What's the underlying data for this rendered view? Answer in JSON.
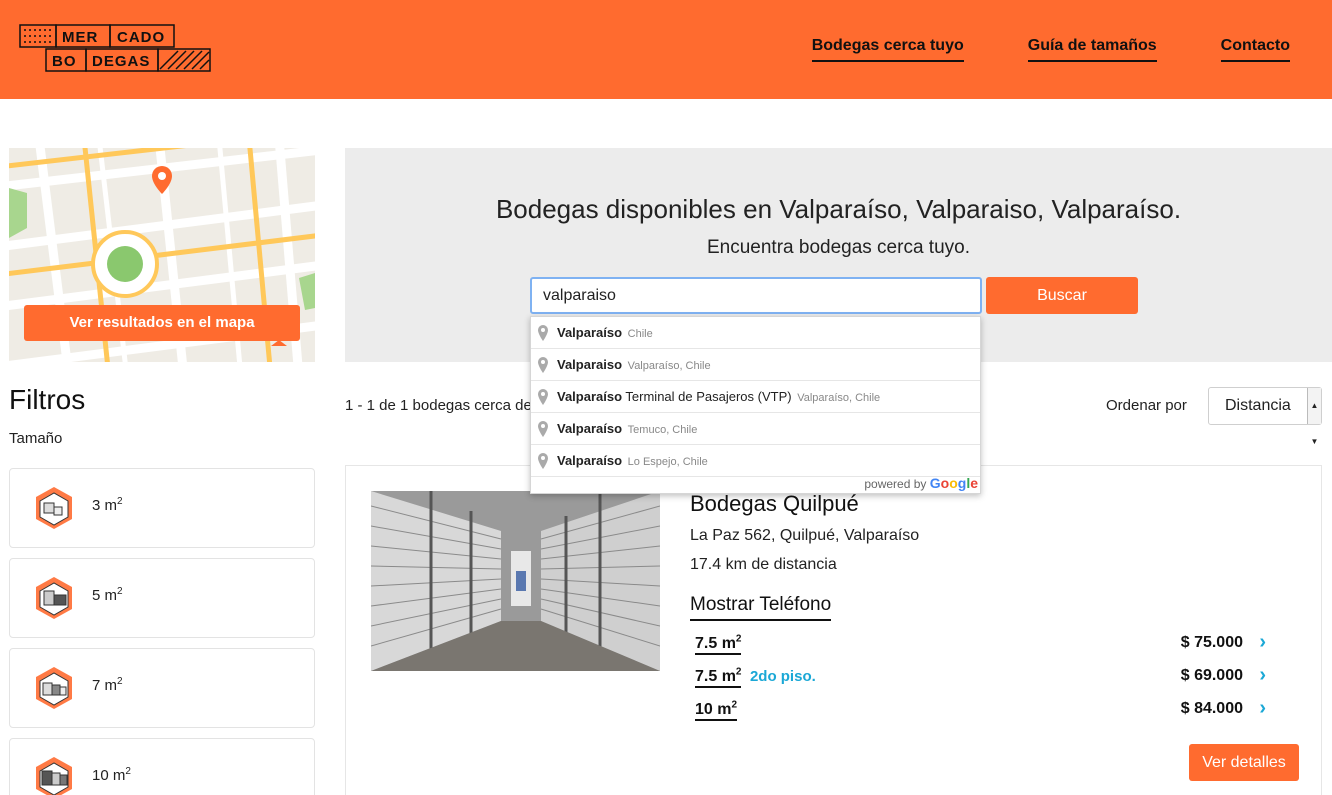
{
  "header": {
    "logo_words": [
      "MER",
      "CADO",
      "BO",
      "DEGAS"
    ],
    "nav": [
      "Bodegas cerca tuyo",
      "Guía de tamaños",
      "Contacto"
    ]
  },
  "map": {
    "button_label": "Ver resultados en el mapa"
  },
  "filters": {
    "title": "Filtros",
    "subtitle": "Tamaño",
    "sizes": [
      {
        "value": "3 m",
        "exp": "2"
      },
      {
        "value": "5 m",
        "exp": "2"
      },
      {
        "value": "7 m",
        "exp": "2"
      },
      {
        "value": "10 m",
        "exp": "2"
      }
    ]
  },
  "hero": {
    "title": "Bodegas disponibles en Valparaíso, Valparaiso, Valparaíso.",
    "subtitle": "Encuentra bodegas cerca tuyo.",
    "search_value": "valparaiso",
    "search_button": "Buscar"
  },
  "autocomplete": {
    "items": [
      {
        "main": "Valparaíso",
        "rest": "",
        "secondary": "Chile"
      },
      {
        "main": "Valparaiso",
        "rest": "",
        "secondary": "Valparaíso, Chile"
      },
      {
        "main": "Valparaíso",
        "rest": " Terminal de Pasajeros (VTP)",
        "secondary": "Valparaíso, Chile"
      },
      {
        "main": "Valparaíso",
        "rest": "",
        "secondary": "Temuco, Chile"
      },
      {
        "main": "Valparaíso",
        "rest": "",
        "secondary": "Lo Espejo, Chile"
      }
    ],
    "powered_by": "powered by",
    "google": "Google"
  },
  "results": {
    "count_text": "1 - 1 de 1 bodegas cerca de",
    "order_label": "Ordenar por",
    "order_value": "Distancia"
  },
  "listing": {
    "name": "Bodegas Quilpué",
    "address": "La Paz 562, Quilpué, Valparaíso",
    "distance": "17.4 km de distancia",
    "phone_link": "Mostrar Teléfono",
    "prices": [
      {
        "size": "7.5 m",
        "exp": "2",
        "note": "",
        "price": "$ 75.000"
      },
      {
        "size": "7.5 m",
        "exp": "2",
        "note": "2do piso.",
        "price": "$ 69.000"
      },
      {
        "size": "10 m",
        "exp": "2",
        "note": "",
        "price": "$ 84.000"
      }
    ],
    "details_button": "Ver detalles"
  },
  "colors": {
    "brand": "#ff6b2f",
    "accent": "#1ba8d6"
  },
  "icons": [
    "map-pin-icon",
    "storage-unit-icon",
    "chevron-right-icon",
    "select-arrow-icon"
  ]
}
